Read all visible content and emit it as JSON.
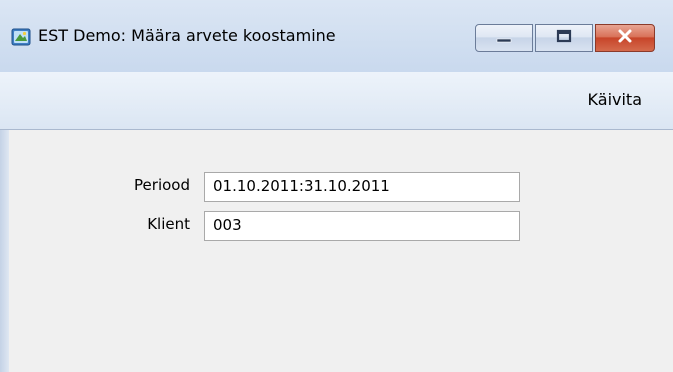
{
  "window": {
    "title": "EST Demo: Määra arvete koostamine",
    "icon": "app-icon"
  },
  "titlebar_buttons": {
    "minimize_icon": "minimize-icon",
    "maximize_icon": "maximize-icon",
    "close_icon": "close-icon"
  },
  "toolbar": {
    "run_label": "Käivita"
  },
  "form": {
    "period_label": "Periood",
    "period_value": "01.10.2011:31.10.2011",
    "client_label": "Klient",
    "client_value": "003"
  },
  "colors": {
    "close_button": "#c7452a",
    "window_bg": "#f0f0f0"
  }
}
